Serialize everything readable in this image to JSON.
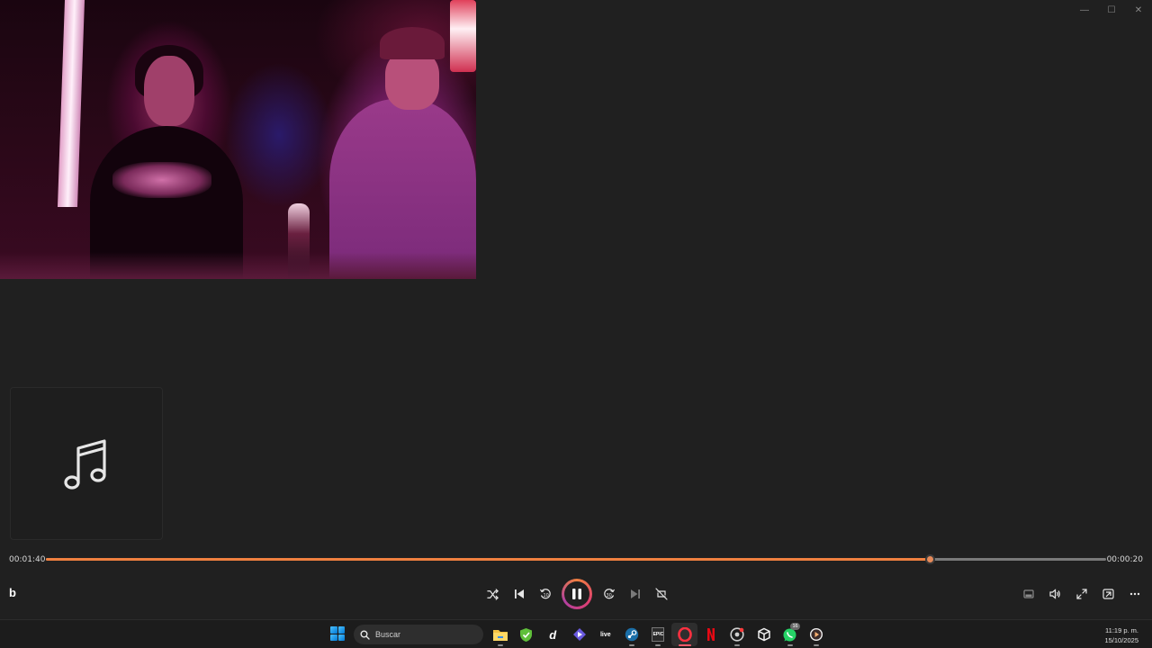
{
  "window": {
    "caption": [
      {
        "name": "minimize",
        "glyph": "—"
      },
      {
        "name": "maximize",
        "glyph": "☐"
      },
      {
        "name": "close",
        "glyph": "✕"
      }
    ]
  },
  "player": {
    "album_art_icon": "music-note-icon",
    "title_initial": "b",
    "elapsed": "00:01:40",
    "remaining": "00:00:20",
    "progress": 0.834,
    "accent_color": "#f08040"
  },
  "controls": {
    "left": [
      "shuffle-icon",
      "previous-icon",
      "rewind-10-icon"
    ],
    "play_state": "pause-icon",
    "right": [
      "forward-30-icon",
      "next-icon",
      "repeat-off-icon"
    ]
  },
  "right_controls": [
    "miniplayer-icon",
    "volume-icon",
    "fullscreen-icon",
    "cast-icon",
    "more-icon"
  ],
  "taskbar": {
    "search_placeholder": "Buscar",
    "apps": [
      "file-explorer",
      "shield-app",
      "dlive-app",
      "discord-app",
      "live-app",
      "steam-app",
      "epic-games-app",
      "opera-app",
      "netflix-app",
      "chrome-beta-app",
      "app-cube",
      "whatsapp-app",
      "media-player-app"
    ],
    "whatsapp_badge": "16",
    "epic_label": "EPIC",
    "live_label": "live",
    "d_label": "d",
    "time": "11:19 p. m.",
    "date": "15/10/2025"
  }
}
